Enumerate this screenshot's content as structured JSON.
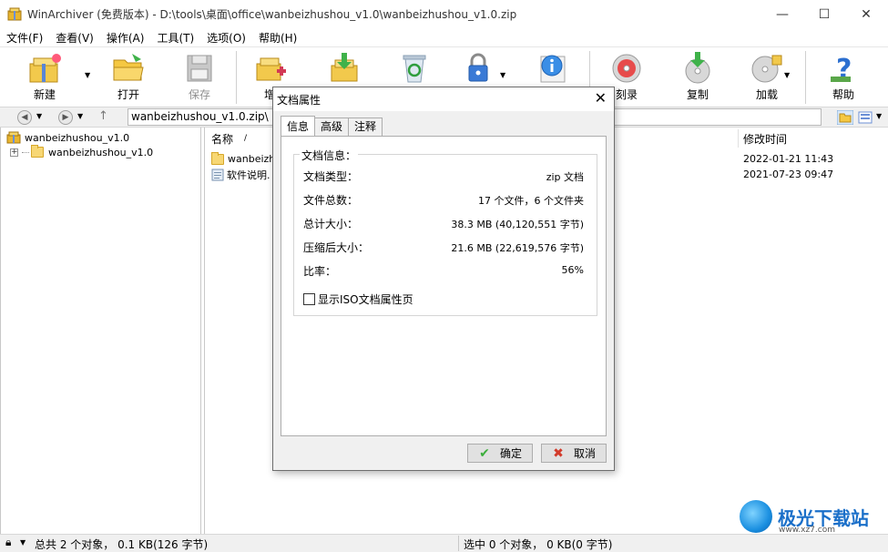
{
  "window": {
    "title": "WinArchiver (免费版本) - D:\\tools\\桌面\\office\\wanbeizhushou_v1.0\\wanbeizhushou_v1.0.zip",
    "minimize_glyph": "—",
    "maximize_glyph": "☐",
    "close_glyph": "✕"
  },
  "menu": [
    {
      "label": "文件(F)"
    },
    {
      "label": "查看(V)"
    },
    {
      "label": "操作(A)"
    },
    {
      "label": "工具(T)"
    },
    {
      "label": "选项(O)"
    },
    {
      "label": "帮助(H)"
    }
  ],
  "toolbar": {
    "new": "新建",
    "open": "打开",
    "save": "保存",
    "add": "增",
    "burn": "刻录",
    "copy": "复制",
    "mount": "加载",
    "help": "帮助",
    "dropdown_glyph": "▼"
  },
  "addressbar": {
    "back_glyph": "◀",
    "forward_glyph": "▶",
    "up_glyph": "↑",
    "path": "wanbeizhushou_v1.0.zip\\",
    "path_suffix": "---"
  },
  "tree": {
    "root": "wanbeizhushou_v1.0",
    "child": "wanbeizhushou_v1.0",
    "expander": "+"
  },
  "filelist": {
    "col_name": "名称",
    "sort_indicator": "/",
    "col_modified": "修改时间",
    "rows": [
      {
        "name": "wanbeizhu",
        "modified": "2022-01-21 11:43"
      },
      {
        "name": "软件说明.",
        "modified": "2021-07-23 09:47"
      }
    ]
  },
  "statusbar": {
    "left": "总共 2 个对象， 0.1 KB(126 字节)",
    "right": "选中 0 个对象， 0 KB(0 字节)"
  },
  "dialog": {
    "title": "文档属性",
    "close_glyph": "✕",
    "tabs": [
      "信息",
      "高级",
      "注释"
    ],
    "group_title": "文档信息：",
    "props": [
      {
        "label": "文档类型：",
        "value": "zip 文档"
      },
      {
        "label": "文件总数：",
        "value": "17 个文件，6 个文件夹"
      },
      {
        "label": "总计大小：",
        "value": "38.3 MB (40,120,551 字节)"
      },
      {
        "label": "压缩后大小：",
        "value": "21.6 MB (22,619,576 字节)"
      },
      {
        "label": "比率：",
        "value": "56%"
      }
    ],
    "checkbox_label": "显示ISO文档属性页",
    "ok_label": "确定",
    "cancel_label": "取消",
    "ok_glyph": "✔",
    "cancel_glyph": "✖"
  },
  "watermark": {
    "text": "极光下载站",
    "url": "www.xz7.com"
  },
  "colors": {
    "accent": "#1a6fc9",
    "ok_check": "#3cae3c",
    "cancel_x": "#d23a2a"
  }
}
